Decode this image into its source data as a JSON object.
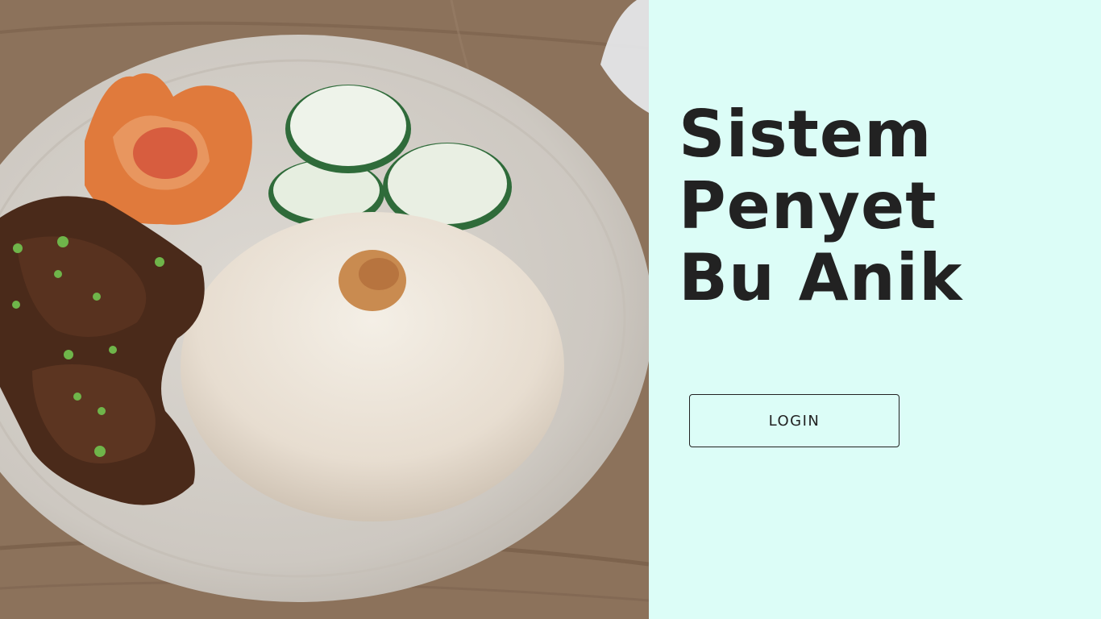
{
  "app": {
    "title_lines": [
      "Sistem",
      "Penyet",
      "Bu Anik"
    ]
  },
  "auth": {
    "login_label": "LOGIN"
  },
  "colors": {
    "panel_background": "#dcfdf7",
    "text": "#222222"
  }
}
